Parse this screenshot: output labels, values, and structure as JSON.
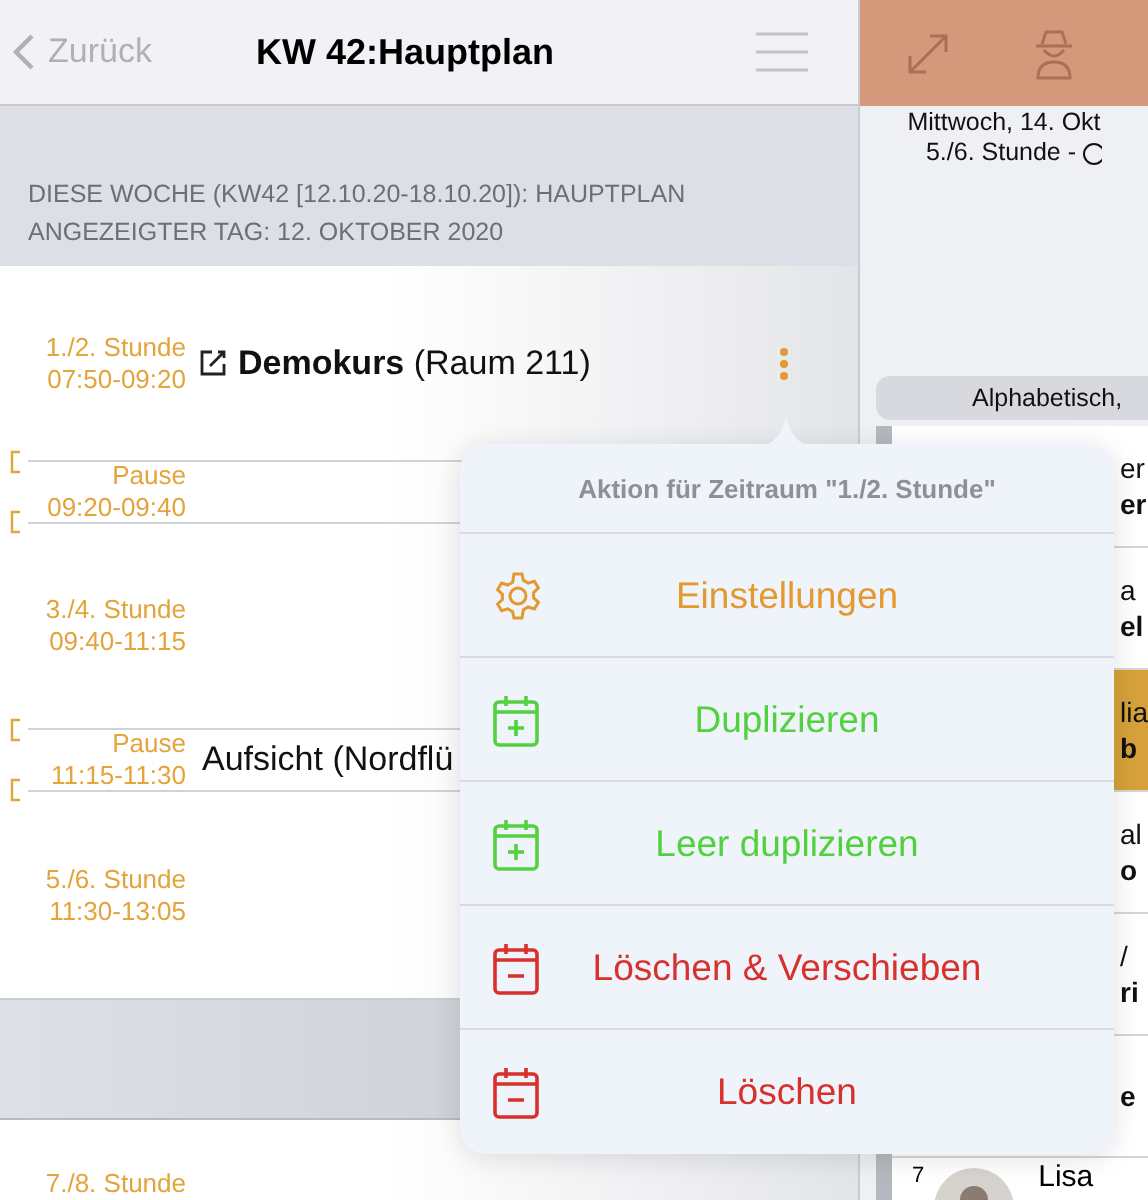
{
  "nav": {
    "back": "Zurück",
    "title": "KW 42:Hauptplan"
  },
  "info": [
    "DIESE WOCHE (KW42 [12.10.20-18.10.20]): HAUPTPLAN",
    "ANGEZEIGTER TAG: 12. OKTOBER 2020"
  ],
  "slots": [
    {
      "kind": "lesson",
      "label": "1./2. Stunde",
      "time": "07:50-09:20",
      "entry": "**Demokurs** (Raum 211)",
      "editable": true,
      "menu": true
    },
    {
      "kind": "break",
      "label": "Pause",
      "time": "09:20-09:40"
    },
    {
      "kind": "lesson",
      "label": "3./4. Stunde",
      "time": "09:40-11:15"
    },
    {
      "kind": "break",
      "label": "Pause",
      "time": "11:15-11:30",
      "entry": "Aufsicht (Nordflü"
    },
    {
      "kind": "lesson",
      "label": "5./6. Stunde",
      "time": "11:30-13:05"
    },
    {
      "kind": "gap"
    },
    {
      "kind": "lesson",
      "label": "7./8. Stunde"
    }
  ],
  "right": {
    "day": "Mittwoch, 14. Okt",
    "slot": "5./6. Stunde -",
    "sort": "Alphabetisch,",
    "students": [
      {
        "line1": "er",
        "line2": "er",
        "highlighted": false
      },
      {
        "line1": "a",
        "line2": "el",
        "highlighted": false
      },
      {
        "line1": "lia",
        "line2": "b",
        "highlighted": true
      },
      {
        "line1": "al",
        "line2": "o",
        "highlighted": false
      },
      {
        "line1": "/",
        "line2": "ri",
        "highlighted": false
      },
      {
        "line2": "e",
        "highlighted": false
      },
      {
        "number": "7",
        "name": "Lisa",
        "avatar": true,
        "highlighted": false
      }
    ]
  },
  "popover": {
    "title": "Aktion für Zeitraum \"1./2. Stunde\"",
    "actions": [
      {
        "kind": "settings",
        "label": "Einstellungen"
      },
      {
        "kind": "add",
        "label": "Duplizieren"
      },
      {
        "kind": "add",
        "label": "Leer duplizieren"
      },
      {
        "kind": "delete",
        "label": "Löschen & Verschieben"
      },
      {
        "kind": "delete",
        "label": "Löschen"
      }
    ]
  }
}
